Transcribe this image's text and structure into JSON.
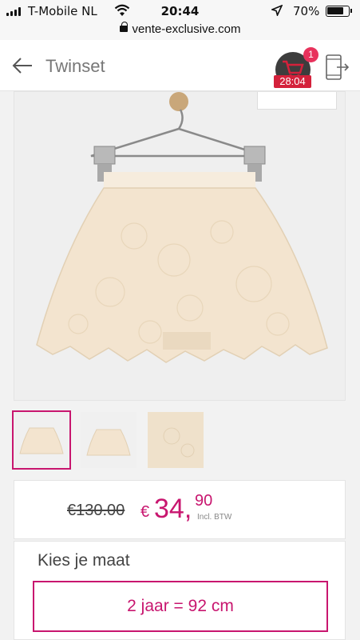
{
  "status_bar": {
    "carrier": "T-Mobile NL",
    "time": "20:44",
    "battery": "70%"
  },
  "browser": {
    "url": "vente-exclusive.com"
  },
  "header": {
    "title": "Twinset",
    "cart_count": "1",
    "cart_timer": "28:04"
  },
  "product": {
    "thumbnail_count": 3,
    "active_thumbnail": 1
  },
  "price": {
    "old": "€130.00",
    "currency": "€",
    "main": "34,",
    "cents": "90",
    "note": "Incl. BTW"
  },
  "size": {
    "label": "Kies je maat",
    "selected": "2 jaar = 92 cm"
  },
  "colors": {
    "accent": "#c8166f",
    "badge": "#e8325c",
    "timer": "#d4213b"
  }
}
